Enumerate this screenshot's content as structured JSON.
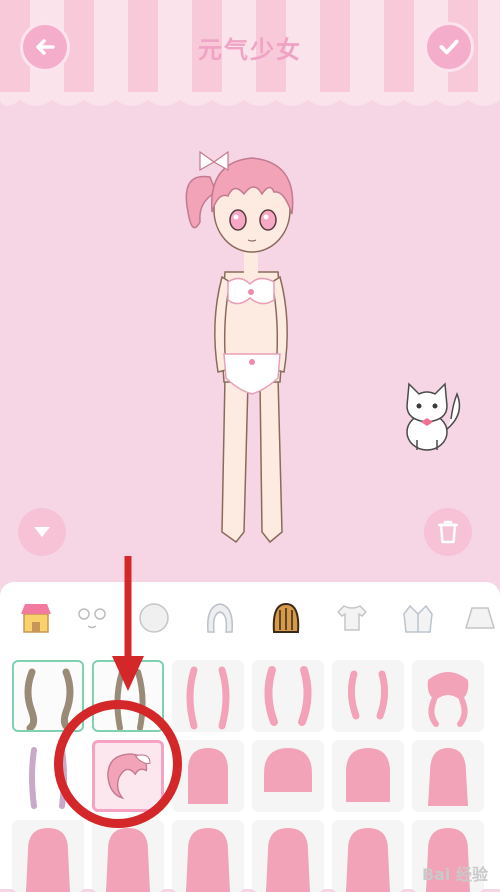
{
  "header": {
    "title": "元气少女"
  },
  "categories": [
    {
      "name": "shop"
    },
    {
      "name": "face"
    },
    {
      "name": "head"
    },
    {
      "name": "hair"
    },
    {
      "name": "hair-back"
    },
    {
      "name": "shirt"
    },
    {
      "name": "jacket"
    },
    {
      "name": "skirt"
    }
  ],
  "watermark": "Bai 经验",
  "colors": {
    "accent": "#f4aecb",
    "owned_border": "#7fd1b0",
    "selected_border": "#f4a3c2",
    "annotation": "#d3272a",
    "hair_pink": "#f2a3b8",
    "hair_brown": "#9a8a78"
  }
}
